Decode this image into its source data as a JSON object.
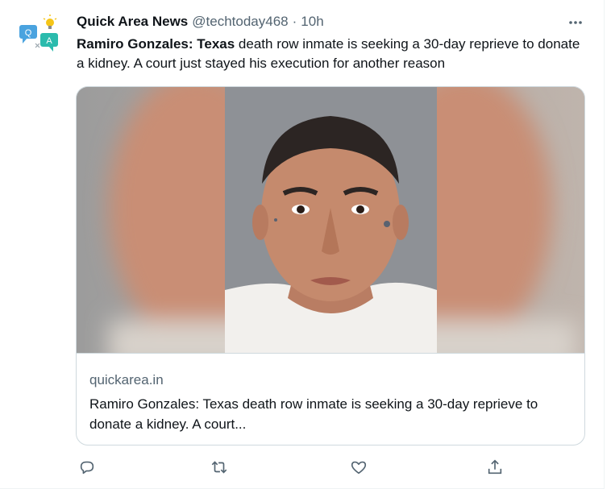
{
  "tweet": {
    "display_name": "Quick Area News",
    "handle": "@techtoday468",
    "separator": "·",
    "time": "10h",
    "text_bold": "Ramiro Gonzales: Texas",
    "text_rest": " death row inmate is seeking a 30-day reprieve to donate a kidney. A court just stayed his execution for another reason"
  },
  "avatar": {
    "bubble_left_letter": "Q",
    "bubble_right_letter": "A",
    "icon": "chat-bubbles-lightbulb-logo"
  },
  "card": {
    "image_description_icon": "mugshot-photo",
    "domain": "quickarea.in",
    "title": "Ramiro Gonzales: Texas death row inmate is seeking a 30-day reprieve to donate a kidney. A court..."
  },
  "actions": {
    "icons": [
      "reply-icon",
      "retweet-icon",
      "like-icon",
      "share-icon"
    ]
  },
  "colors": {
    "text_primary": "#0f1419",
    "text_secondary": "#536471",
    "border": "#cfd9de",
    "avatar_blue": "#4aa3df",
    "avatar_teal": "#2bbbad",
    "avatar_bulb": "#f5c518"
  }
}
